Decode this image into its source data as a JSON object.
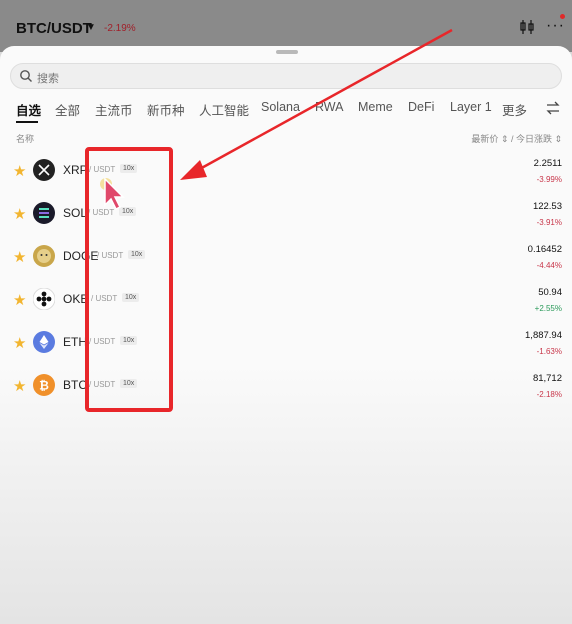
{
  "header": {
    "pair": "BTC/USDT",
    "change": "-2.19%",
    "caret": "▼",
    "more": "···"
  },
  "search": {
    "placeholder": "搜索"
  },
  "tabs": [
    "自选",
    "全部",
    "主流币",
    "新币种",
    "人工智能",
    "Solana",
    "RWA",
    "Meme",
    "DeFi",
    "Layer 1",
    "更多"
  ],
  "columns": {
    "name": "名称",
    "price_change": "最新价 ⇕ / 今日涨跌 ⇕"
  },
  "rows": [
    {
      "symbol": "XRP",
      "quote": "/ USDT",
      "leverage": "10x",
      "price": "2.2511",
      "change": "-3.99%",
      "dir": "down",
      "icon": "xrp-icon",
      "color": "#222222"
    },
    {
      "symbol": "SOL",
      "quote": "/ USDT",
      "leverage": "10x",
      "price": "122.53",
      "change": "-3.91%",
      "dir": "down",
      "icon": "sol-icon",
      "color": "#1a1a2a"
    },
    {
      "symbol": "DOGE",
      "quote": "/ USDT",
      "leverage": "10x",
      "price": "0.16452",
      "change": "-4.44%",
      "dir": "down",
      "icon": "doge-icon",
      "color": "#c9a64a"
    },
    {
      "symbol": "OKB",
      "quote": "/ USDT",
      "leverage": "10x",
      "price": "50.94",
      "change": "+2.55%",
      "dir": "up",
      "icon": "okb-icon",
      "color": "#111111"
    },
    {
      "symbol": "ETH",
      "quote": "/ USDT",
      "leverage": "10x",
      "price": "1,887.94",
      "change": "-1.63%",
      "dir": "down",
      "icon": "eth-icon",
      "color": "#5a7be0"
    },
    {
      "symbol": "BTC",
      "quote": "/ USDT",
      "leverage": "10x",
      "price": "81,712",
      "change": "-2.18%",
      "dir": "down",
      "icon": "btc-icon",
      "color": "#f0902a"
    }
  ],
  "colors": {
    "accent_red": "#e8262a",
    "down": "#c8364a",
    "up": "#2a9a5a",
    "star": "#f2b530"
  }
}
